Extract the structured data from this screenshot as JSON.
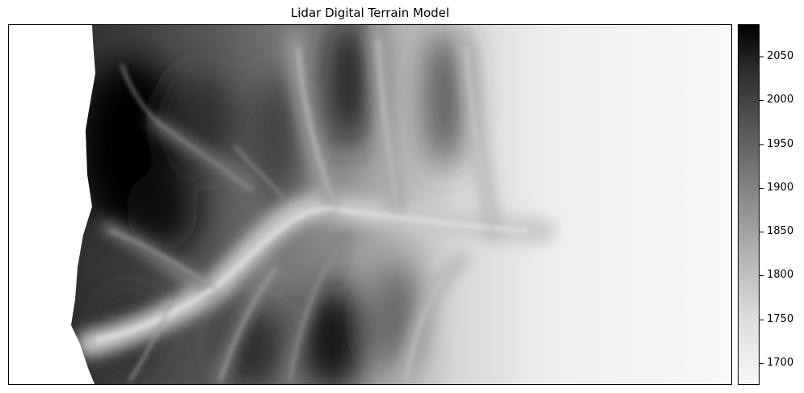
{
  "chart_data": {
    "type": "heatmap",
    "title": "Lidar Digital Terrain Model",
    "xlabel": "",
    "ylabel": "",
    "colormap": "Greys",
    "colorbar": {
      "range": [
        1675,
        2087
      ],
      "ticks": [
        2050,
        2000,
        1950,
        1900,
        1850,
        1800,
        1750,
        1700
      ],
      "tick_labels": [
        "2050",
        "2000",
        "1950",
        "1900",
        "1850",
        "1800",
        "1750",
        "1700"
      ]
    },
    "axes_ticks_visible": false,
    "nodata_color": "#ffffff"
  }
}
